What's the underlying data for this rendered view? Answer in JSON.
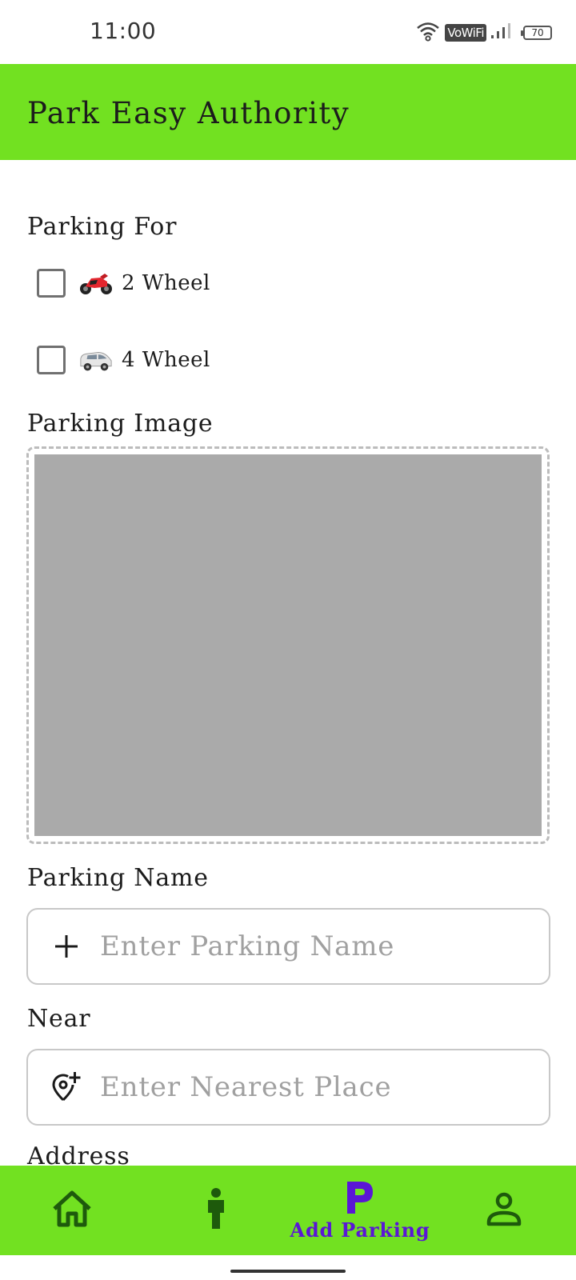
{
  "status_bar": {
    "time": "11:00",
    "network_label": "VoWiFi",
    "battery_level": "70"
  },
  "app_bar": {
    "title": "Park Easy Authority"
  },
  "parking_for": {
    "label": "Parking For",
    "options": [
      {
        "label": "2 Wheel",
        "checked": false,
        "icon": "motorcycle-icon"
      },
      {
        "label": "4 Wheel",
        "checked": false,
        "icon": "van-icon"
      }
    ]
  },
  "parking_image": {
    "label": "Parking Image"
  },
  "parking_name": {
    "label": "Parking Name",
    "placeholder": "Enter Parking Name",
    "value": "",
    "icon": "plus-icon"
  },
  "near": {
    "label": "Near",
    "placeholder": "Enter Nearest Place",
    "value": "",
    "icon": "add-location-icon"
  },
  "address": {
    "label": "Address"
  },
  "bottom_nav": {
    "items": [
      {
        "icon": "home-icon",
        "label": "",
        "active": false
      },
      {
        "icon": "person-icon",
        "label": "",
        "active": false
      },
      {
        "icon": "parking-icon",
        "label": "Add Parking",
        "active": true
      },
      {
        "icon": "account-icon",
        "label": "",
        "active": false
      }
    ]
  },
  "colors": {
    "accent_green": "#72e121",
    "active_purple": "#5a16d6",
    "inactive_icon": "#1e5a0c",
    "image_placeholder": "#aaaaaa"
  }
}
